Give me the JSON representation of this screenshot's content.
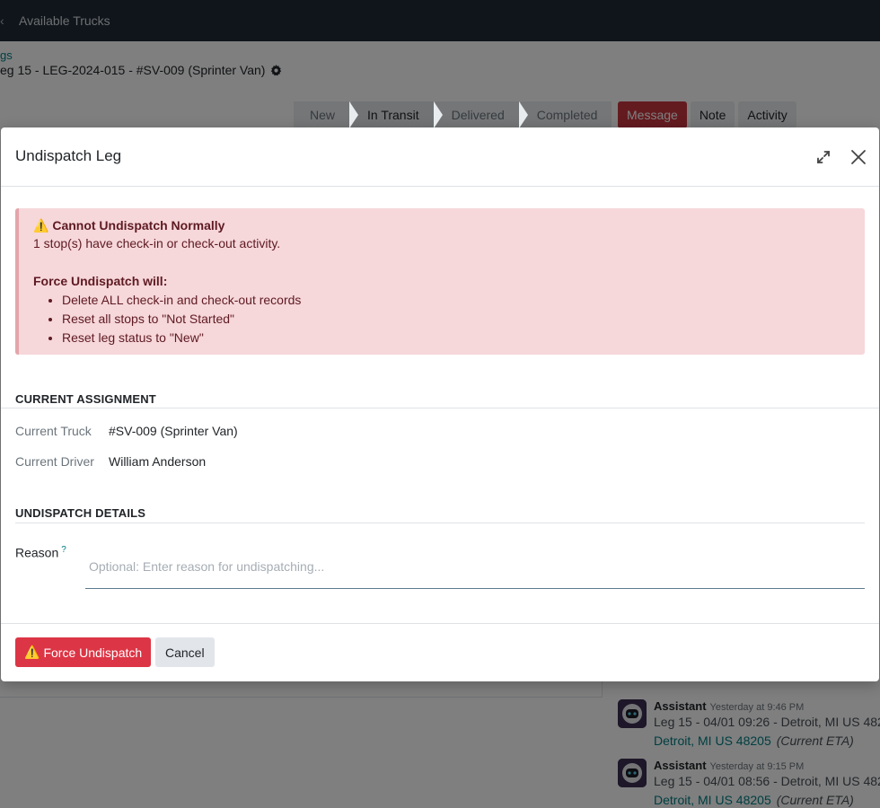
{
  "app": {
    "menu_label": "Available Trucks",
    "breadcrumb_parent": "gs",
    "breadcrumb_current": "eg 15 - LEG-2024-015 - #SV-009 (Sprinter Van)"
  },
  "statusbar": {
    "stages": [
      "New",
      "In Transit",
      "Delivered",
      "Completed"
    ],
    "active": "In Transit"
  },
  "chatter": {
    "buttons": [
      "Message",
      "Note",
      "Activity"
    ],
    "messages": [
      {
        "author": "Assistant",
        "time": "Yesterday at 9:46 PM",
        "body": "Leg 15 - 04/01 09:26 - Detroit, MI US 482",
        "location": "Detroit, MI US 48205",
        "note": "(Current ETA)"
      },
      {
        "author": "Assistant",
        "time": "Yesterday at 9:15 PM",
        "body": "Leg 15 - 04/01 08:56 - Detroit, MI US 482",
        "location": "Detroit, MI US 48205",
        "note": "(Current ETA)"
      }
    ]
  },
  "modal": {
    "title": "Undispatch Leg",
    "alert": {
      "icon": "⚠️",
      "title": "Cannot Undispatch Normally",
      "message": "1 stop(s) have check-in or check-out activity.",
      "subtitle": "Force Undispatch will:",
      "items": [
        "Delete ALL check-in and check-out records",
        "Reset all stops to \"Not Started\"",
        "Reset leg status to \"New\""
      ]
    },
    "current_assignment": {
      "heading": "CURRENT ASSIGNMENT",
      "truck_label": "Current Truck",
      "truck_value": "#SV-009 (Sprinter Van)",
      "driver_label": "Current Driver",
      "driver_value": "William Anderson"
    },
    "undispatch_details": {
      "heading": "UNDISPATCH DETAILS",
      "reason_label": "Reason",
      "reason_help": "?",
      "reason_value": "",
      "reason_placeholder": "Optional: Enter reason for undispatching..."
    },
    "footer": {
      "force_icon": "⚠️",
      "force_label": "Force Undispatch",
      "cancel_label": "Cancel"
    }
  },
  "colors": {
    "navbar": "#1e2a36",
    "danger": "#dc3545",
    "alert_bg": "#f6d7da",
    "link": "#017e84"
  }
}
